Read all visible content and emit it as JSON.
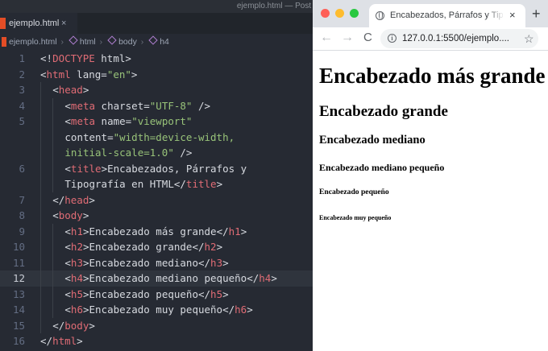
{
  "editor": {
    "window_title": "ejemplo.html — Post",
    "tab": {
      "label": "ejemplo.html",
      "close": "×"
    },
    "breadcrumb": [
      "ejemplo.html",
      "html",
      "body",
      "h4"
    ],
    "active_line": 12,
    "lines": [
      {
        "n": "1",
        "indent": 0,
        "tokens": [
          [
            "punct",
            "<!"
          ],
          [
            "kw",
            "DOCTYPE"
          ],
          [
            "plain",
            " html"
          ],
          [
            "punct",
            ">"
          ]
        ]
      },
      {
        "n": "2",
        "indent": 0,
        "tokens": [
          [
            "punct",
            "<"
          ],
          [
            "tag",
            "html"
          ],
          [
            "attr",
            " lang"
          ],
          [
            "punct",
            "="
          ],
          [
            "str",
            "\"en\""
          ],
          [
            "punct",
            ">"
          ]
        ]
      },
      {
        "n": "3",
        "indent": 1,
        "tokens": [
          [
            "punct",
            "<"
          ],
          [
            "tag",
            "head"
          ],
          [
            "punct",
            ">"
          ]
        ]
      },
      {
        "n": "4",
        "indent": 2,
        "tokens": [
          [
            "punct",
            "<"
          ],
          [
            "tag",
            "meta"
          ],
          [
            "attr",
            " charset"
          ],
          [
            "punct",
            "="
          ],
          [
            "str",
            "\"UTF-8\""
          ],
          [
            "punct",
            " />"
          ]
        ]
      },
      {
        "n": "5",
        "indent": 2,
        "tokens": [
          [
            "punct",
            "<"
          ],
          [
            "tag",
            "meta"
          ],
          [
            "attr",
            " name"
          ],
          [
            "punct",
            "="
          ],
          [
            "str",
            "\"viewport\""
          ]
        ]
      },
      {
        "n": "",
        "indent": 2,
        "tokens": [
          [
            "attr",
            "content"
          ],
          [
            "punct",
            "="
          ],
          [
            "str",
            "\"width=device-width,"
          ]
        ]
      },
      {
        "n": "",
        "indent": 2,
        "tokens": [
          [
            "str",
            "initial-scale=1.0\""
          ],
          [
            "punct",
            " />"
          ]
        ]
      },
      {
        "n": "6",
        "indent": 2,
        "tokens": [
          [
            "punct",
            "<"
          ],
          [
            "tag",
            "title"
          ],
          [
            "punct",
            ">"
          ],
          [
            "plain",
            "Encabezados, Párrafos y"
          ]
        ]
      },
      {
        "n": "",
        "indent": 2,
        "tokens": [
          [
            "plain",
            "Tipografía en HTML"
          ],
          [
            "punct",
            "</"
          ],
          [
            "tag",
            "title"
          ],
          [
            "punct",
            ">"
          ]
        ]
      },
      {
        "n": "7",
        "indent": 1,
        "tokens": [
          [
            "punct",
            "</"
          ],
          [
            "tag",
            "head"
          ],
          [
            "punct",
            ">"
          ]
        ]
      },
      {
        "n": "8",
        "indent": 1,
        "tokens": [
          [
            "punct",
            "<"
          ],
          [
            "tag",
            "body"
          ],
          [
            "punct",
            ">"
          ]
        ]
      },
      {
        "n": "9",
        "indent": 2,
        "tokens": [
          [
            "punct",
            "<"
          ],
          [
            "tag",
            "h1"
          ],
          [
            "punct",
            ">"
          ],
          [
            "plain",
            "Encabezado más grande"
          ],
          [
            "punct",
            "</"
          ],
          [
            "tag",
            "h1"
          ],
          [
            "punct",
            ">"
          ]
        ]
      },
      {
        "n": "10",
        "indent": 2,
        "tokens": [
          [
            "punct",
            "<"
          ],
          [
            "tag",
            "h2"
          ],
          [
            "punct",
            ">"
          ],
          [
            "plain",
            "Encabezado grande"
          ],
          [
            "punct",
            "</"
          ],
          [
            "tag",
            "h2"
          ],
          [
            "punct",
            ">"
          ]
        ]
      },
      {
        "n": "11",
        "indent": 2,
        "tokens": [
          [
            "punct",
            "<"
          ],
          [
            "tag",
            "h3"
          ],
          [
            "punct",
            ">"
          ],
          [
            "plain",
            "Encabezado mediano"
          ],
          [
            "punct",
            "</"
          ],
          [
            "tag",
            "h3"
          ],
          [
            "punct",
            ">"
          ]
        ]
      },
      {
        "n": "12",
        "indent": 2,
        "tokens": [
          [
            "punct",
            "<"
          ],
          [
            "tag",
            "h4"
          ],
          [
            "punct",
            ">"
          ],
          [
            "plain",
            "Encabezado mediano pequeño"
          ],
          [
            "punct",
            "</"
          ],
          [
            "tag",
            "h4"
          ],
          [
            "punct",
            ">"
          ]
        ]
      },
      {
        "n": "13",
        "indent": 2,
        "tokens": [
          [
            "punct",
            "<"
          ],
          [
            "tag",
            "h5"
          ],
          [
            "punct",
            ">"
          ],
          [
            "plain",
            "Encabezado pequeño"
          ],
          [
            "punct",
            "</"
          ],
          [
            "tag",
            "h5"
          ],
          [
            "punct",
            ">"
          ]
        ]
      },
      {
        "n": "14",
        "indent": 2,
        "tokens": [
          [
            "punct",
            "<"
          ],
          [
            "tag",
            "h6"
          ],
          [
            "punct",
            ">"
          ],
          [
            "plain",
            "Encabezado muy pequeño"
          ],
          [
            "punct",
            "</"
          ],
          [
            "tag",
            "h6"
          ],
          [
            "punct",
            ">"
          ]
        ]
      },
      {
        "n": "15",
        "indent": 1,
        "tokens": [
          [
            "punct",
            "</"
          ],
          [
            "tag",
            "body"
          ],
          [
            "punct",
            ">"
          ]
        ]
      },
      {
        "n": "16",
        "indent": 0,
        "tokens": [
          [
            "punct",
            "</"
          ],
          [
            "tag",
            "html"
          ],
          [
            "punct",
            ">"
          ]
        ]
      }
    ]
  },
  "browser": {
    "tab_title": "Encabezados, Párrafos y Tipografía en HTML",
    "tab_close": "×",
    "new_tab": "+",
    "url": "127.0.0.1:5500/ejemplo....",
    "nav": {
      "back": "←",
      "forward": "→",
      "reload": "C",
      "star": "☆",
      "info": "i"
    },
    "traffic_colors": [
      "#fe5f57",
      "#febc2e",
      "#28c840"
    ],
    "headings": {
      "h1": "Encabezado más grande",
      "h2": "Encabezado grande",
      "h3": "Encabezado mediano",
      "h4": "Encabezado mediano pequeño",
      "h5": "Encabezado pequeño",
      "h6": "Encabezado muy pequeño"
    }
  }
}
